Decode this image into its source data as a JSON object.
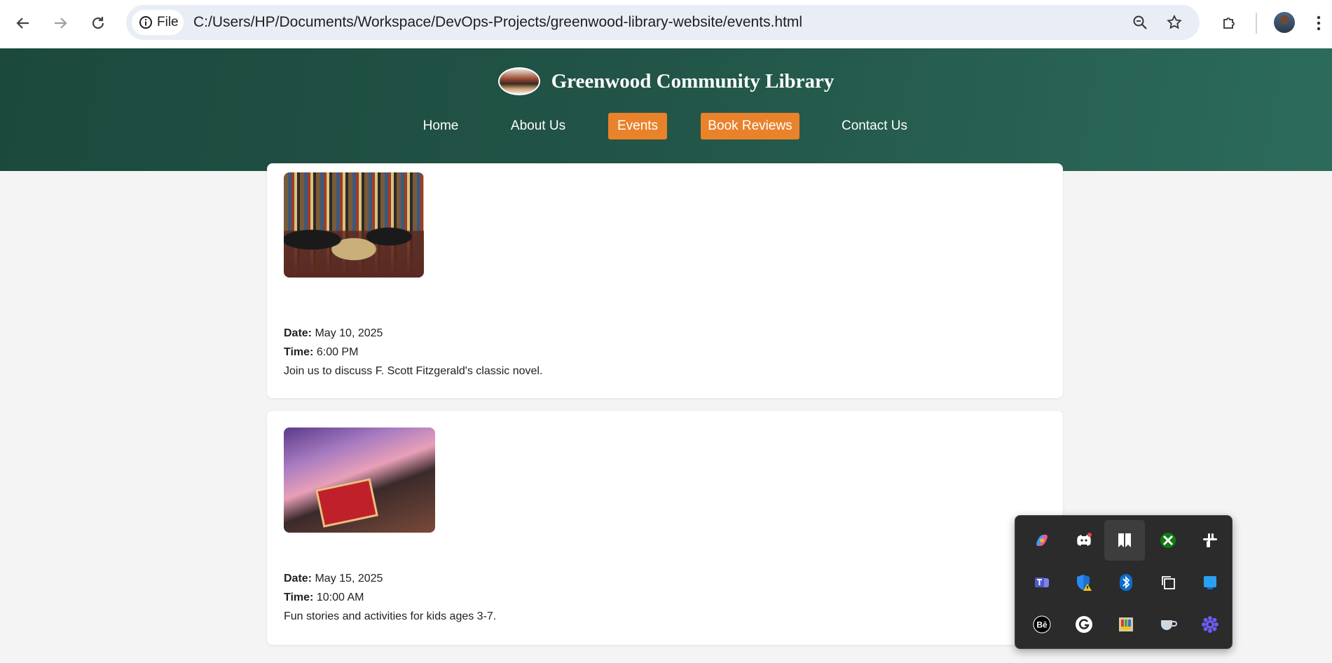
{
  "browser": {
    "file_label": "File",
    "url": "C:/Users/HP/Documents/Workspace/DevOps-Projects/greenwood-library-website/events.html"
  },
  "site": {
    "title": "Greenwood Community Library",
    "nav": [
      {
        "label": "Home",
        "active": false
      },
      {
        "label": "About Us",
        "active": false
      },
      {
        "label": "Events",
        "active": true
      },
      {
        "label": "Book Reviews",
        "active": true
      },
      {
        "label": "Contact Us",
        "active": false
      }
    ],
    "accent_color": "#e9822a",
    "header_color": "#215346"
  },
  "events": [
    {
      "date_label": "Date:",
      "date": "May 10, 2025",
      "time_label": "Time:",
      "time": "6:00 PM",
      "description": "Join us to discuss F. Scott Fitzgerald's classic novel."
    },
    {
      "date_label": "Date:",
      "date": "May 15, 2025",
      "time_label": "Time:",
      "time": "10:00 AM",
      "description": "Fun stories and activities for kids ages 3-7."
    }
  ],
  "tray_icons": [
    "copilot-icon",
    "discord-icon",
    "bookmark-app-icon",
    "xbox-icon",
    "slack-icon",
    "teams-icon",
    "defender-warning-icon",
    "bluetooth-icon",
    "copy-app-icon",
    "blue-app-icon",
    "behance-icon",
    "grammarly-icon",
    "color-picker-icon",
    "cup-app-icon",
    "gear-flower-icon"
  ]
}
